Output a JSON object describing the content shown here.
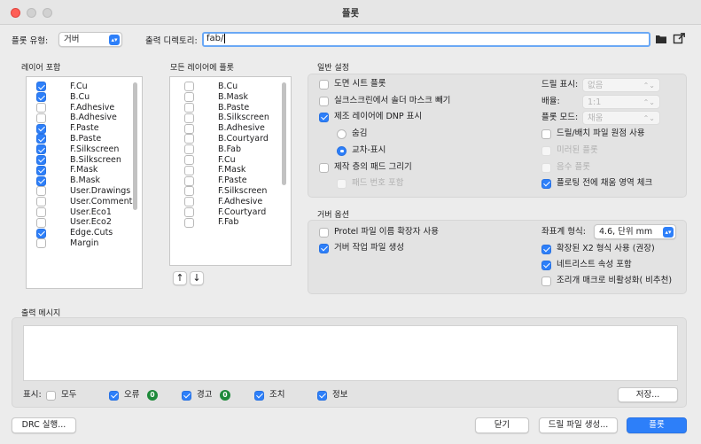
{
  "window": {
    "title": "플롯"
  },
  "top": {
    "plot_format_label": "플롯 유형:",
    "plot_format_value": "거버",
    "output_dir_label": "출력 디렉토리:",
    "output_dir_value": "fab/"
  },
  "layers": {
    "title": "레이어 포함",
    "items": [
      {
        "name": "F.Cu",
        "checked": true
      },
      {
        "name": "B.Cu",
        "checked": true
      },
      {
        "name": "F.Adhesive",
        "checked": false
      },
      {
        "name": "B.Adhesive",
        "checked": false
      },
      {
        "name": "F.Paste",
        "checked": true
      },
      {
        "name": "B.Paste",
        "checked": true
      },
      {
        "name": "F.Silkscreen",
        "checked": true
      },
      {
        "name": "B.Silkscreen",
        "checked": true
      },
      {
        "name": "F.Mask",
        "checked": true
      },
      {
        "name": "B.Mask",
        "checked": true
      },
      {
        "name": "User.Drawings",
        "checked": false
      },
      {
        "name": "User.Comments",
        "checked": false
      },
      {
        "name": "User.Eco1",
        "checked": false
      },
      {
        "name": "User.Eco2",
        "checked": false
      },
      {
        "name": "Edge.Cuts",
        "checked": true
      },
      {
        "name": "Margin",
        "checked": false
      }
    ]
  },
  "all_layers": {
    "title": "모든 레이어에 플롯",
    "items": [
      {
        "name": "B.Cu",
        "checked": false
      },
      {
        "name": "B.Mask",
        "checked": false
      },
      {
        "name": "B.Paste",
        "checked": false
      },
      {
        "name": "B.Silkscreen",
        "checked": false
      },
      {
        "name": "B.Adhesive",
        "checked": false
      },
      {
        "name": "B.Courtyard",
        "checked": false
      },
      {
        "name": "B.Fab",
        "checked": false
      },
      {
        "name": "F.Cu",
        "checked": false
      },
      {
        "name": "F.Mask",
        "checked": false
      },
      {
        "name": "F.Paste",
        "checked": false
      },
      {
        "name": "F.Silkscreen",
        "checked": false
      },
      {
        "name": "F.Adhesive",
        "checked": false
      },
      {
        "name": "F.Courtyard",
        "checked": false
      },
      {
        "name": "F.Fab",
        "checked": false
      }
    ],
    "move_up": "↑",
    "move_down": "↓"
  },
  "general": {
    "title": "일반 설정",
    "plot_sheet": "도면 시트 플롯",
    "subtract_mask": "실크스크린에서 솔더 마스크 빼기",
    "dnp_label": "제조 레이어에 DNP 표시",
    "dnp_hide": "숨김",
    "dnp_crossout": "교차-표시",
    "pad_outlines": "제작 층의 패드 그리기",
    "pad_numbers": "패드 번호 포함",
    "drill_marks_label": "드릴 표시:",
    "drill_marks_value": "없음",
    "scale_label": "배율:",
    "scale_value": "1:1",
    "plot_mode_label": "플롯 모드:",
    "plot_mode_value": "채움",
    "use_aux_origin": "드릴/배치 파일 원점 사용",
    "mirrored": "미러된 플롯",
    "negative": "음수 플롯",
    "check_zones": "플로팅 전에 채움 영역 체크"
  },
  "gerber": {
    "title": "거버 옵션",
    "protel_ext": "Protel 파일 이름 확장자 사용",
    "job_file": "거버 작업 파일 생성",
    "coord_label": "좌표계 형식:",
    "coord_value": "4.6, 단위 mm",
    "x2_format": "확장된 X2 형식 사용 (권장)",
    "netlist_attr": "네트리스트 속성 포함",
    "disable_macros": "조리개 매크로 비활성화( 비추천)"
  },
  "messages": {
    "title": "출력 메시지",
    "show_label": "표시:",
    "all": "모두",
    "errors": "오류",
    "errors_count": "0",
    "warnings": "경고",
    "warnings_count": "0",
    "actions": "조치",
    "infos": "정보",
    "save_button": "저장..."
  },
  "footer": {
    "drc_button": "DRC 실행...",
    "close_button": "닫기",
    "drill_button": "드릴 파일 생성...",
    "plot_button": "플롯"
  },
  "colors": {
    "accent": "#2d7ff9",
    "badge": "#1e8a3a",
    "focus_ring": "#6aa8f5"
  },
  "icons": {
    "folder": "folder-icon",
    "open_external": "open-external-icon"
  }
}
